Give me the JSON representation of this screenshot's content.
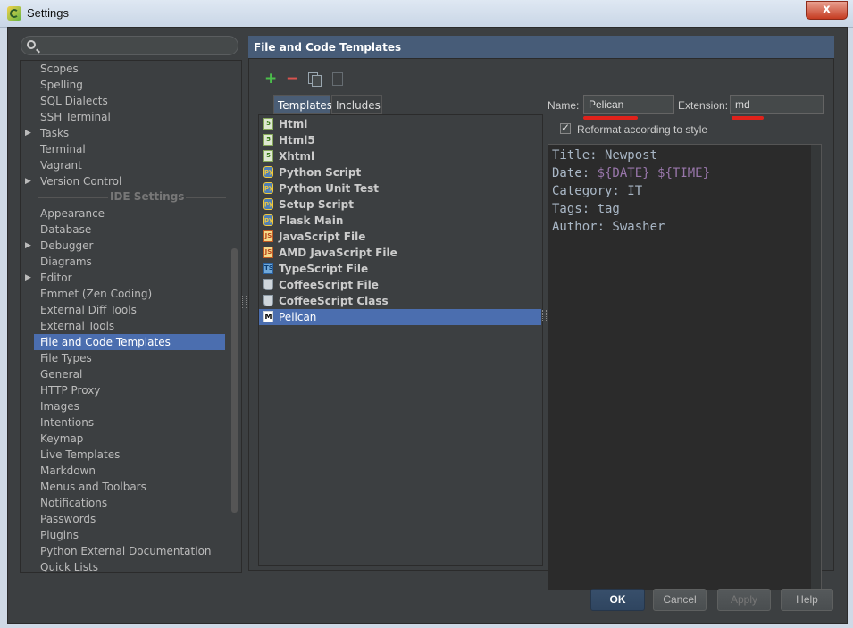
{
  "window": {
    "title": "Settings",
    "close_glyph": "x"
  },
  "sidebar": {
    "search_placeholder": "",
    "group_label": "IDE Settings",
    "items_before": [
      {
        "label": "Scopes"
      },
      {
        "label": "Spelling"
      },
      {
        "label": "SQL Dialects"
      },
      {
        "label": "SSH Terminal"
      },
      {
        "label": "Tasks",
        "expandable": true
      },
      {
        "label": "Terminal"
      },
      {
        "label": "Vagrant"
      },
      {
        "label": "Version Control",
        "expandable": true
      }
    ],
    "items_after": [
      {
        "label": "Appearance"
      },
      {
        "label": "Database"
      },
      {
        "label": "Debugger",
        "expandable": true
      },
      {
        "label": "Diagrams"
      },
      {
        "label": "Editor",
        "expandable": true
      },
      {
        "label": "Emmet (Zen Coding)"
      },
      {
        "label": "External Diff Tools"
      },
      {
        "label": "External Tools"
      },
      {
        "label": "File and Code Templates",
        "selected": true
      },
      {
        "label": "File Types"
      },
      {
        "label": "General"
      },
      {
        "label": "HTTP Proxy"
      },
      {
        "label": "Images"
      },
      {
        "label": "Intentions"
      },
      {
        "label": "Keymap"
      },
      {
        "label": "Live Templates"
      },
      {
        "label": "Markdown"
      },
      {
        "label": "Menus and Toolbars"
      },
      {
        "label": "Notifications"
      },
      {
        "label": "Passwords"
      },
      {
        "label": "Plugins"
      },
      {
        "label": "Python External Documentation"
      },
      {
        "label": "Quick Lists"
      }
    ]
  },
  "panel": {
    "title": "File and Code Templates",
    "tabs": [
      {
        "label": "Templates",
        "active": true
      },
      {
        "label": "Includes",
        "active": false
      }
    ],
    "templates": [
      {
        "label": "Html",
        "icon": "html"
      },
      {
        "label": "Html5",
        "icon": "html"
      },
      {
        "label": "Xhtml",
        "icon": "html"
      },
      {
        "label": "Python Script",
        "icon": "py"
      },
      {
        "label": "Python Unit Test",
        "icon": "py"
      },
      {
        "label": "Setup Script",
        "icon": "py"
      },
      {
        "label": "Flask Main",
        "icon": "py"
      },
      {
        "label": "JavaScript File",
        "icon": "js"
      },
      {
        "label": "AMD JavaScript File",
        "icon": "js"
      },
      {
        "label": "TypeScript File",
        "icon": "ts"
      },
      {
        "label": "CoffeeScript File",
        "icon": "coffee"
      },
      {
        "label": "CoffeeScript Class",
        "icon": "coffee"
      },
      {
        "label": "Pelican",
        "icon": "md",
        "selected": true
      }
    ],
    "name_label": "Name:",
    "name_value": "Pelican",
    "extension_label": "Extension:",
    "extension_value": "md",
    "reformat_label": "Reformat according to style",
    "reformat_checked": true,
    "code": [
      [
        {
          "t": "Title: Newpost"
        }
      ],
      [
        {
          "t": "Date: "
        },
        {
          "t": "${DATE}",
          "var": true
        },
        {
          "t": " "
        },
        {
          "t": "${TIME}",
          "var": true
        }
      ],
      [
        {
          "t": "Category: IT"
        }
      ],
      [
        {
          "t": "Tags: tag"
        }
      ],
      [
        {
          "t": "Author: Swasher"
        }
      ]
    ]
  },
  "buttons": {
    "ok": "OK",
    "cancel": "Cancel",
    "apply": "Apply",
    "help": "Help"
  },
  "colors": {
    "selection": "#4b6eaf",
    "background": "#3c3f41",
    "highlight_underline": "#e0221b",
    "template_var": "#9876aa"
  }
}
